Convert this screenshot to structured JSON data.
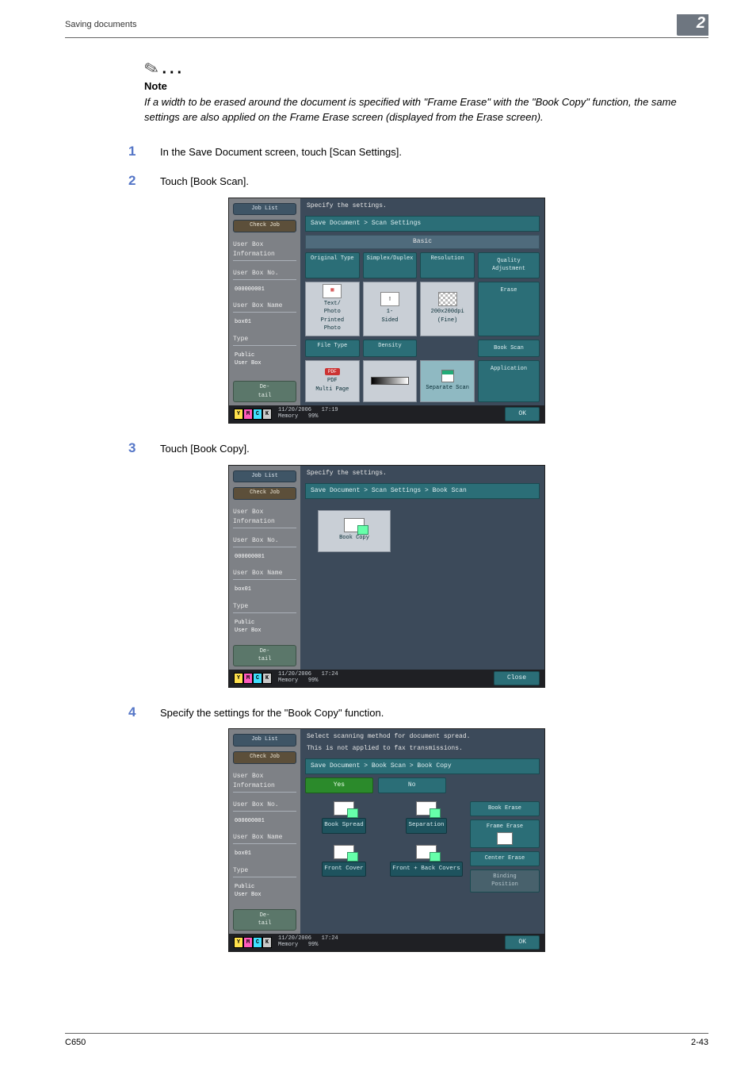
{
  "chapter_badge": "2",
  "running_head": "Saving documents",
  "note": {
    "title": "Note",
    "body": "If a width to be erased around the document is specified with \"Frame Erase\" with the \"Book Copy\" function, the same settings are also applied on the Frame Erase screen (displayed from the Erase screen)."
  },
  "steps": {
    "s1": {
      "num": "1",
      "text": "In the Save Document screen, touch [Scan Settings]."
    },
    "s2": {
      "num": "2",
      "text": "Touch [Book Scan]."
    },
    "s3": {
      "num": "3",
      "text": "Touch [Book Copy]."
    },
    "s4": {
      "num": "4",
      "text": "Specify the settings for the \"Book Copy\" function."
    }
  },
  "side": {
    "job_list": "Job List",
    "check_job": "Check Job",
    "user_box_info": "User Box\nInformation",
    "user_box_no_lbl": "User Box No.",
    "user_box_no_val": "000000001",
    "user_box_name_lbl": "User Box Name",
    "user_box_name_val": "box01",
    "type_lbl": "Type",
    "type_val": "Public\nUser Box",
    "detail": "De-\ntail"
  },
  "shot1": {
    "headline": "Specify the settings.",
    "breadcrumb": "Save Document > Scan Settings",
    "tab_basic": "Basic",
    "hdr": {
      "original_type": "Original Type",
      "simplex_duplex": "Simplex/Duplex",
      "resolution": "Resolution",
      "quality": "Quality\nAdjustment",
      "file_type": "File Type",
      "density": "Density"
    },
    "vals": {
      "original_type_caption": "Text/\nPhoto\nPrinted\nPhoto",
      "simplex_caption": "1-\nSided",
      "resolution_caption": "200x200dpi\n(Fine)",
      "file_type_caption": "PDF\nMulti Page",
      "pdf_chip": "PDF",
      "separate_scan": "Separate Scan"
    },
    "right": {
      "erase": "Erase",
      "book_scan": "Book Scan",
      "application": "Application"
    },
    "foot": {
      "date": "11/20/2006",
      "time": "17:19",
      "mem_lbl": "Memory",
      "mem_val": "99%",
      "ok": "OK"
    }
  },
  "shot2": {
    "headline": "Specify the settings.",
    "breadcrumb": "Save Document > Scan Settings > Book Scan",
    "book_copy": "Book Copy",
    "foot": {
      "date": "11/20/2006",
      "time": "17:24",
      "mem_lbl": "Memory",
      "mem_val": "99%",
      "close": "Close"
    }
  },
  "shot3": {
    "headline1": "Select scanning method for document spread.",
    "headline2": "This is not applied to fax transmissions.",
    "breadcrumb": "Save Document > Book Scan > Book Copy",
    "yes": "Yes",
    "no": "No",
    "opts": {
      "book_spread": "Book Spread",
      "separation": "Separation",
      "front_cover": "Front Cover",
      "front_back": "Front + Back Covers"
    },
    "right": {
      "book_erase": "Book Erase",
      "frame_erase": "Frame Erase",
      "center_erase": "Center Erase",
      "binding_pos": "Binding\nPosition"
    },
    "foot": {
      "date": "11/20/2006",
      "time": "17:24",
      "mem_lbl": "Memory",
      "mem_val": "99%",
      "ok": "OK"
    }
  },
  "pagefoot": {
    "left": "C650",
    "right": "2-43"
  }
}
